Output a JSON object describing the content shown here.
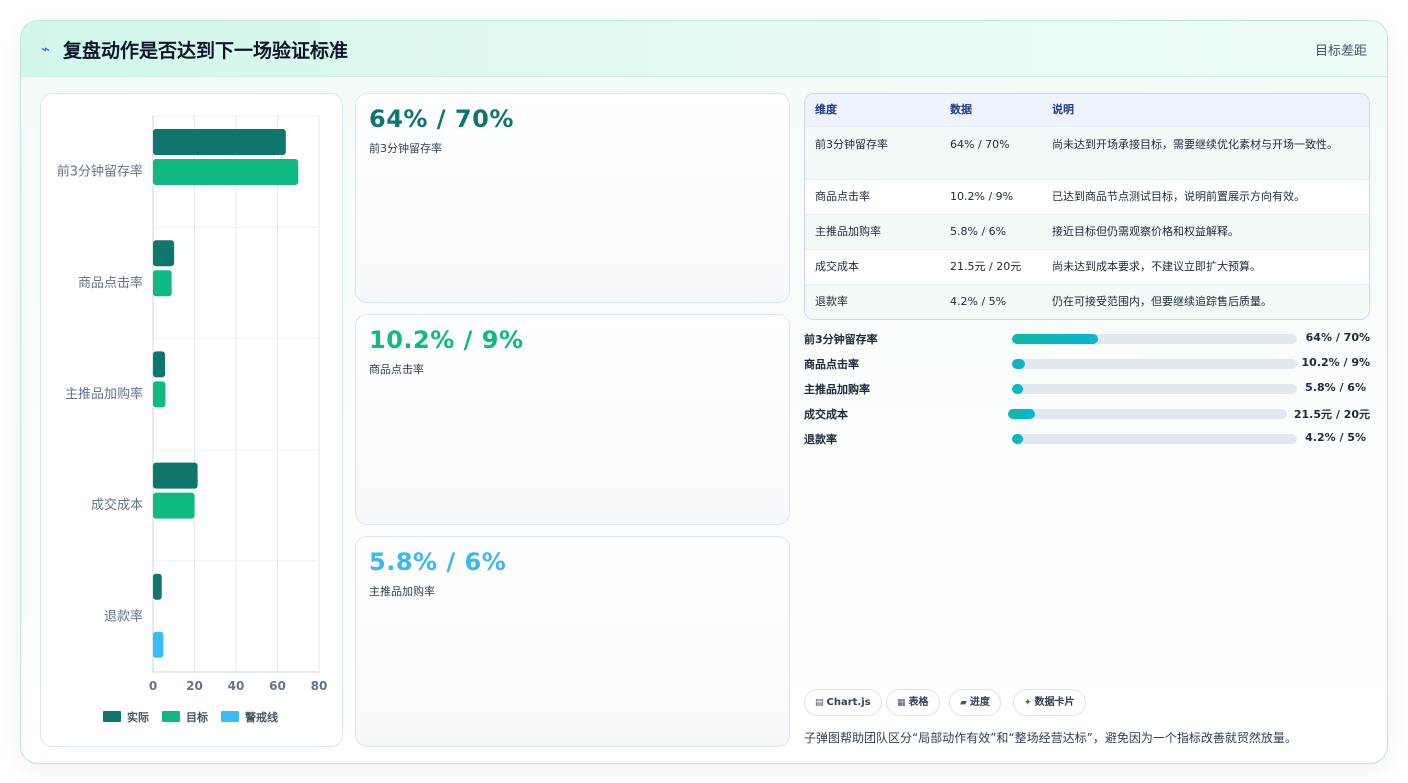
{
  "header": {
    "icon": "bolt-icon",
    "title": "复盘动作是否达到下一场验证标准",
    "right_label": "目标差距"
  },
  "colors": {
    "actual": "#0f766e",
    "target": "#10b981",
    "warning": "#38bdf8",
    "accent_blue": "#3ab8ef"
  },
  "chart_data": {
    "type": "bar",
    "orientation": "horizontal",
    "categories": [
      "前3分钟留存率",
      "商品点击率",
      "主推品加购率",
      "成交成本",
      "退款率"
    ],
    "series": [
      {
        "name": "实际",
        "values": [
          64,
          10.2,
          5.8,
          21.5,
          4.2
        ]
      },
      {
        "name": "目标",
        "values": [
          70,
          9,
          6,
          null,
          null
        ]
      },
      {
        "name": "警戒线",
        "values": [
          null,
          null,
          null,
          20,
          5
        ]
      }
    ],
    "note_target_bar_values": [
      70,
      9,
      6,
      20,
      5
    ],
    "xlim": [
      0,
      80
    ],
    "xticks": [
      "0",
      "20",
      "40",
      "60",
      "80"
    ],
    "legend_position": "bottom",
    "grid": true
  },
  "stats": [
    {
      "value": "64% / 70%",
      "label": "前3分钟留存率",
      "color": "#0f766e"
    },
    {
      "value": "10.2% / 9%",
      "label": "商品点击率",
      "color": "#10b981"
    },
    {
      "value": "5.8% / 6%",
      "label": "主推品加购率",
      "color": "#3ab8ef"
    }
  ],
  "table": {
    "headers": [
      "维度",
      "数据",
      "说明"
    ],
    "rows": [
      {
        "dim": "前3分钟留存率",
        "data": "64% / 70%",
        "note": "尚未达到开场承接目标，需要继续优化素材与开场一致性。"
      },
      {
        "dim": "商品点击率",
        "data": "10.2% / 9%",
        "note": "已达到商品节点测试目标，说明前置展示方向有效。"
      },
      {
        "dim": "主推品加购率",
        "data": "5.8% / 6%",
        "note": "接近目标但仍需观察价格和权益解释。"
      },
      {
        "dim": "成交成本",
        "data": "21.5元 / 20元",
        "note": "尚未达到成本要求，不建议立即扩大预算。"
      },
      {
        "dim": "退款率",
        "data": "4.2% / 5%",
        "note": "仍在可接受范围内，但要继续追踪售后质量。"
      }
    ]
  },
  "progress": [
    {
      "label": "前3分钟留存率",
      "value": "64% / 70%",
      "fraction": 0.3
    },
    {
      "label": "商品点击率",
      "value": "10.2% / 9%",
      "fraction": 0.045
    },
    {
      "label": "主推品加购率",
      "value": "5.8% / 6%",
      "fraction": 0.04
    },
    {
      "label": "成交成本",
      "value": "21.5元 / 20元",
      "fraction": 0.095
    },
    {
      "label": "退款率",
      "value": "4.2% / 5%",
      "fraction": 0.04
    }
  ],
  "pills": [
    {
      "icon": "chart-icon",
      "glyph": "▤",
      "label": "Chart.js"
    },
    {
      "icon": "table-icon",
      "glyph": "▦",
      "label": "表格"
    },
    {
      "icon": "progress-icon",
      "glyph": "▰",
      "label": "进度"
    },
    {
      "icon": "sparkle-icon",
      "glyph": "✦",
      "label": "数据卡片"
    }
  ],
  "footnote": "子弹图帮助团队区分“局部动作有效”和“整场经营达标”，避免因为一个指标改善就贸然放量。"
}
